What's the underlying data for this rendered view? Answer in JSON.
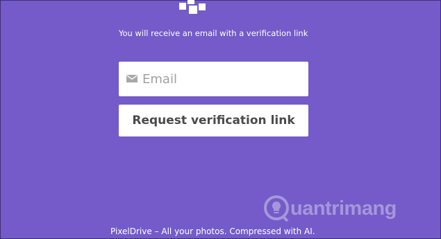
{
  "form": {
    "instructions": "You will receive an email with a verification link",
    "email_placeholder": "Email",
    "email_value": "",
    "request_button_label": "Request verification link"
  },
  "watermark": {
    "text": "uantrimang"
  },
  "footer": {
    "text": "PixelDrive – All your photos. Compressed with AI."
  },
  "icons": {
    "logo": "pixeldrive-logo-icon",
    "email": "mail-icon",
    "watermark": "lightbulb-icon"
  },
  "colors": {
    "background": "#745bc9",
    "surface": "#ffffff",
    "button_text": "#4a4a4a",
    "placeholder": "#a0a0a0"
  }
}
